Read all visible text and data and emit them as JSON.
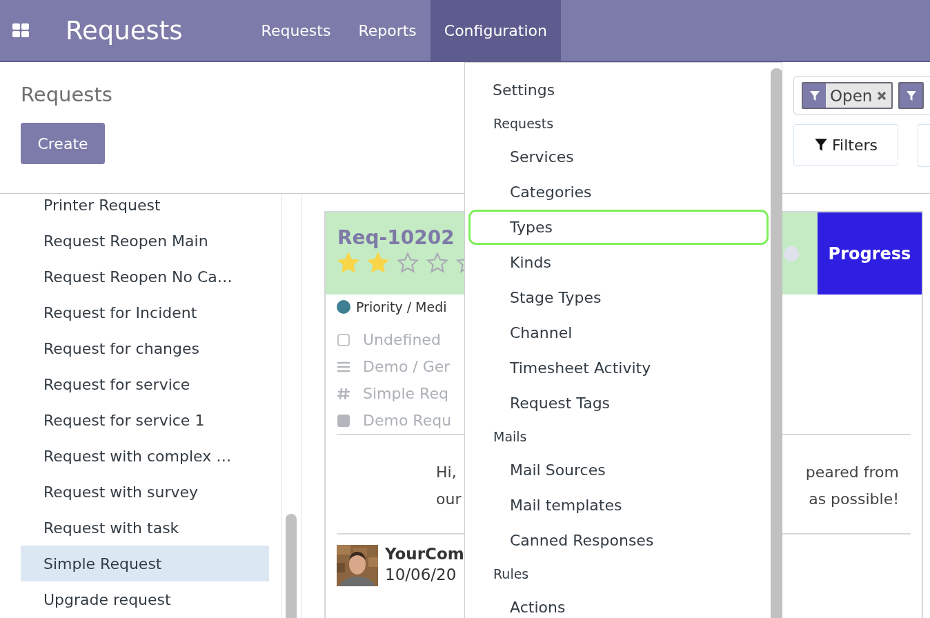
{
  "app": {
    "title": "Requests"
  },
  "nav": [
    {
      "label": "Requests",
      "selected": false
    },
    {
      "label": "Reports",
      "selected": false
    },
    {
      "label": "Configuration",
      "selected": true
    }
  ],
  "control_panel": {
    "title": "Requests",
    "create_button": "Create",
    "facets": [
      {
        "kind": "filter",
        "label": "Open"
      },
      {
        "kind": "filter"
      }
    ],
    "filters_button": "Filters"
  },
  "sidebar": {
    "items": [
      {
        "label": "Printer Request",
        "selected": false
      },
      {
        "label": "Request Reopen Main",
        "selected": false
      },
      {
        "label": "Request Reopen No Ca…",
        "selected": false
      },
      {
        "label": "Request for Incident",
        "selected": false
      },
      {
        "label": "Request for changes",
        "selected": false
      },
      {
        "label": "Request for service",
        "selected": false
      },
      {
        "label": "Request for service 1",
        "selected": false
      },
      {
        "label": "Request with complex …",
        "selected": false
      },
      {
        "label": "Request with survey",
        "selected": false
      },
      {
        "label": "Request with task",
        "selected": false
      },
      {
        "label": "Simple Request",
        "selected": true
      },
      {
        "label": "Upgrade request",
        "selected": false
      }
    ]
  },
  "card": {
    "reference": "Req-10202",
    "stars": 2,
    "stage": "Progress",
    "priority": "Priority / Medi",
    "fields": [
      {
        "kind": "checkbox",
        "text": "Undefined"
      },
      {
        "kind": "list",
        "text": "Demo / Ger"
      },
      {
        "kind": "hash",
        "text": "Simple Req"
      },
      {
        "kind": "square",
        "text": "Demo Requ"
      }
    ],
    "message_left": [
      "Hi,",
      "our"
    ],
    "message_right": [
      "peared from",
      "as possible!"
    ],
    "author": "YourCom",
    "date": "10/06/20"
  },
  "menu": {
    "entries": [
      {
        "kind": "item",
        "label": "Settings"
      },
      {
        "kind": "section",
        "label": "Requests",
        "children": [
          {
            "label": "Services",
            "highlighted": false
          },
          {
            "label": "Categories",
            "highlighted": false
          },
          {
            "label": "Types",
            "highlighted": true
          },
          {
            "label": "Kinds",
            "highlighted": false
          },
          {
            "label": "Stage Types",
            "highlighted": false
          },
          {
            "label": "Channel",
            "highlighted": false
          },
          {
            "label": "Timesheet Activity",
            "highlighted": false
          },
          {
            "label": "Request Tags",
            "highlighted": false
          }
        ]
      },
      {
        "kind": "section",
        "label": "Mails",
        "children": [
          {
            "label": "Mail Sources",
            "highlighted": false
          },
          {
            "label": "Mail templates",
            "highlighted": false
          },
          {
            "label": "Canned Responses",
            "highlighted": false
          }
        ]
      },
      {
        "kind": "section",
        "label": "Rules",
        "children": [
          {
            "label": "Actions",
            "highlighted": false
          }
        ]
      }
    ]
  }
}
